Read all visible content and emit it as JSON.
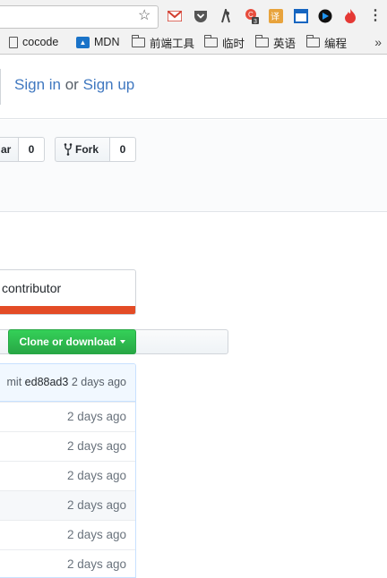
{
  "browser": {
    "bookmarks": [
      {
        "label": "cocode",
        "icon": "doc-icon"
      },
      {
        "label": "MDN",
        "icon": "mdn-icon"
      },
      {
        "label": "前端工具",
        "icon": "folder-icon"
      },
      {
        "label": "临时",
        "icon": "folder-icon"
      },
      {
        "label": "英语",
        "icon": "folder-icon"
      },
      {
        "label": "编程",
        "icon": "folder-icon"
      }
    ],
    "overflow_label": "»",
    "extension_badge": "3"
  },
  "header": {
    "sign_in": "Sign in",
    "or": "or",
    "sign_up": "Sign up"
  },
  "repo": {
    "star_label": "ar",
    "star_count": "0",
    "fork_label": "Fork",
    "fork_count": "0",
    "contributors_text": "l contributor",
    "language_color": "#e34c26",
    "clone_label": "Clone or download"
  },
  "file_list": {
    "latest_commit_prefix": "mit",
    "latest_commit_sha": "ed88ad3",
    "latest_commit_age": "2 days ago",
    "rows": [
      {
        "age": "2 days ago"
      },
      {
        "age": "2 days ago"
      },
      {
        "age": "2 days ago"
      },
      {
        "age": "2 days ago"
      },
      {
        "age": "2 days ago"
      },
      {
        "age": "2 days ago"
      }
    ]
  }
}
